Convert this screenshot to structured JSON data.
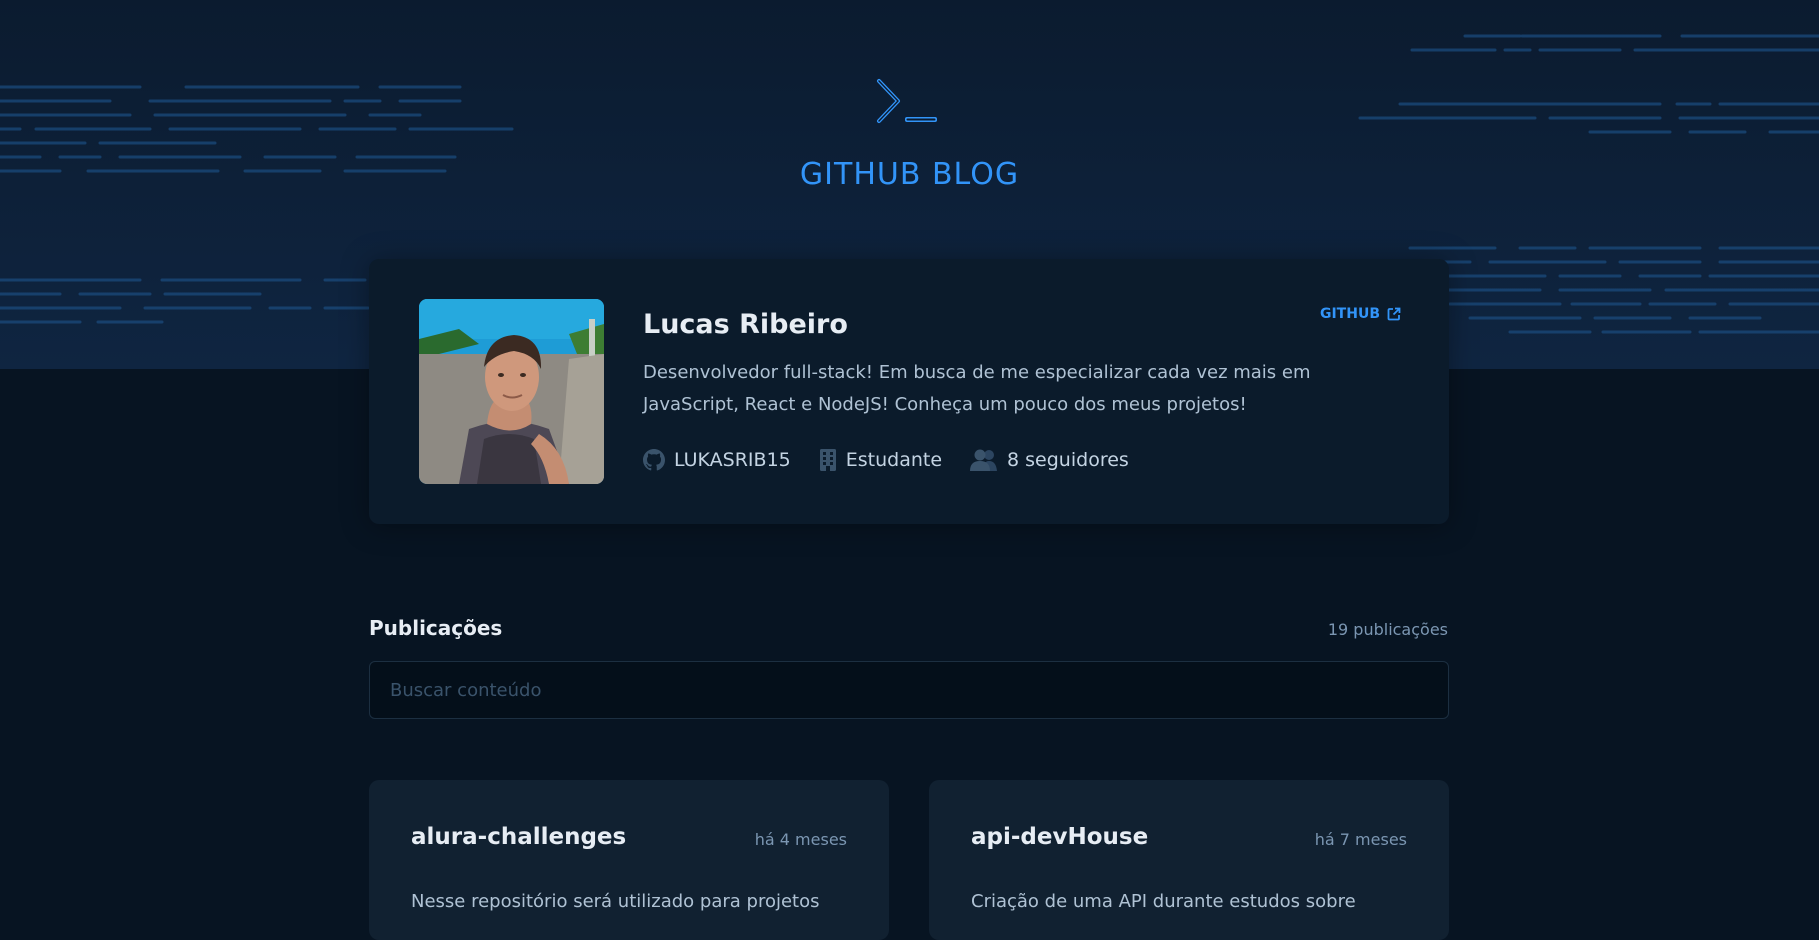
{
  "header": {
    "logo_icon": "terminal-prompt-icon",
    "title": "GITHUB BLOG",
    "accent_color": "#3294f8"
  },
  "profile": {
    "name": "Lucas Ribeiro",
    "github_label": "GITHUB",
    "github_icon": "external-link-icon",
    "bio": "Desenvolvedor full-stack! Em busca de me especializar cada vez mais em JavaScript, React e NodeJS! Conheça um pouco dos meus projetos!",
    "username": "LUKASRIB15",
    "company": "Estudante",
    "followers": "8 seguidores",
    "avatar_icon": "profile-photo"
  },
  "publications": {
    "title": "Publicações",
    "count": "19 publicações",
    "search_placeholder": "Buscar conteúdo"
  },
  "posts": [
    {
      "title": "alura-challenges",
      "date": "há 4 meses",
      "excerpt": "Nesse repositório será utilizado para projetos"
    },
    {
      "title": "api-devHouse",
      "date": "há 7 meses",
      "excerpt": "Criação de uma API durante estudos sobre"
    }
  ]
}
